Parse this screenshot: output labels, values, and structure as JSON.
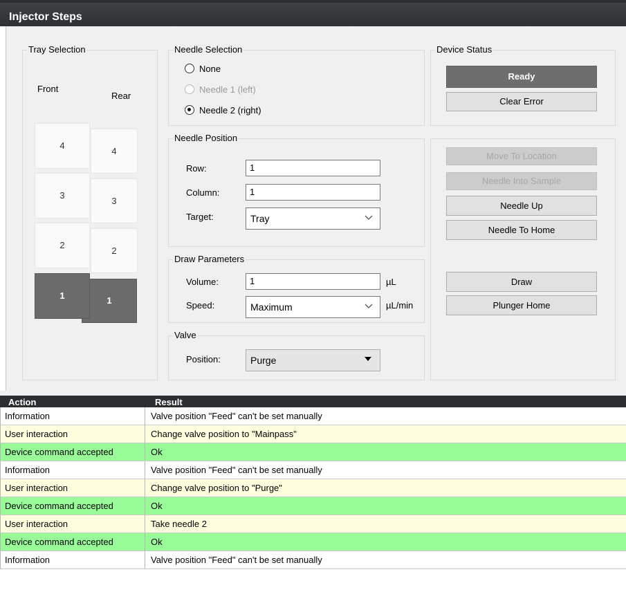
{
  "window": {
    "title": "Injector Steps"
  },
  "tray_selection": {
    "legend": "Tray Selection",
    "front_label": "Front",
    "rear_label": "Rear",
    "front_tiles": [
      "4",
      "3",
      "2",
      "1"
    ],
    "rear_tiles": [
      "4",
      "3",
      "2",
      "1"
    ],
    "selected": "1"
  },
  "needle_selection": {
    "legend": "Needle Selection",
    "options": [
      {
        "label": "None",
        "checked": false,
        "enabled": true
      },
      {
        "label": "Needle 1 (left)",
        "checked": false,
        "enabled": false
      },
      {
        "label": "Needle 2 (right)",
        "checked": true,
        "enabled": true
      }
    ]
  },
  "needle_position": {
    "legend": "Needle Position",
    "row_label": "Row:",
    "row_value": "1",
    "column_label": "Column:",
    "column_value": "1",
    "target_label": "Target:",
    "target_value": "Tray"
  },
  "draw_parameters": {
    "legend": "Draw Parameters",
    "volume_label": "Volume:",
    "volume_value": "1",
    "volume_unit": "µL",
    "speed_label": "Speed:",
    "speed_value": "Maximum",
    "speed_unit": "µL/min"
  },
  "valve": {
    "legend": "Valve",
    "position_label": "Position:",
    "position_value": "Purge"
  },
  "device_status": {
    "legend": "Device Status",
    "status": "Ready",
    "clear_error": "Clear Error"
  },
  "commands": {
    "move_to_location": "Move To Location",
    "needle_into_sample": "Needle Into Sample",
    "needle_up": "Needle Up",
    "needle_to_home": "Needle To Home",
    "draw": "Draw",
    "plunger_home": "Plunger Home"
  },
  "log": {
    "headers": {
      "action": "Action",
      "result": "Result"
    },
    "rows": [
      {
        "action": "Information",
        "result": "Valve position \"Feed\" can't be set manually",
        "kind": "info"
      },
      {
        "action": "User interaction",
        "result": "Change valve position to \"Mainpass\"",
        "kind": "user"
      },
      {
        "action": "Device command accepted",
        "result": "Ok",
        "kind": "ok"
      },
      {
        "action": "Information",
        "result": "Valve position \"Feed\" can't be set manually",
        "kind": "info"
      },
      {
        "action": "User interaction",
        "result": "Change valve position to \"Purge\"",
        "kind": "user"
      },
      {
        "action": "Device command accepted",
        "result": "Ok",
        "kind": "ok"
      },
      {
        "action": "User interaction",
        "result": "Take needle 2",
        "kind": "user"
      },
      {
        "action": "Device command accepted",
        "result": "Ok",
        "kind": "ok"
      },
      {
        "action": "Information",
        "result": "Valve position \"Feed\" can't be set manually",
        "kind": "info"
      }
    ]
  },
  "colors": {
    "info_row": "#ffffff",
    "user_row": "#ffffe0",
    "ok_row": "#98fb98",
    "selected_tile": "#6b6b6b",
    "status_button": "#6e6e6e"
  }
}
